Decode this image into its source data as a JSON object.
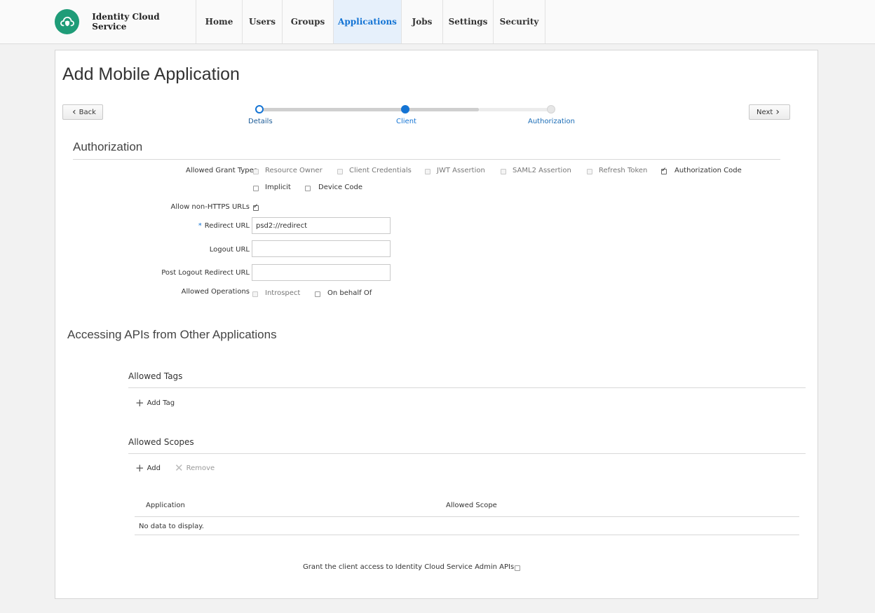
{
  "header": {
    "brand": "Identity Cloud Service",
    "nav": [
      {
        "label": "Home",
        "active": false
      },
      {
        "label": "Users",
        "active": false
      },
      {
        "label": "Groups",
        "active": false
      },
      {
        "label": "Applications",
        "active": true
      },
      {
        "label": "Jobs",
        "active": false
      },
      {
        "label": "Settings",
        "active": false
      },
      {
        "label": "Security",
        "active": false
      }
    ]
  },
  "page": {
    "title": "Add Mobile Application",
    "back_label": "Back",
    "next_label": "Next"
  },
  "train": {
    "steps": [
      {
        "label": "Details",
        "state": "visited"
      },
      {
        "label": "Client",
        "state": "current"
      },
      {
        "label": "Authorization",
        "state": "unvisited"
      }
    ]
  },
  "authorization": {
    "title": "Authorization",
    "grant_types_label": "Allowed Grant Types",
    "grant_types": [
      {
        "label": "Resource Owner",
        "checked": false,
        "disabled": true
      },
      {
        "label": "Client Credentials",
        "checked": false,
        "disabled": true
      },
      {
        "label": "JWT Assertion",
        "checked": false,
        "disabled": true
      },
      {
        "label": "SAML2 Assertion",
        "checked": false,
        "disabled": true
      },
      {
        "label": "Refresh Token",
        "checked": false,
        "disabled": true
      },
      {
        "label": "Authorization Code",
        "checked": true,
        "disabled": false
      },
      {
        "label": "Implicit",
        "checked": false,
        "disabled": false
      },
      {
        "label": "Device Code",
        "checked": false,
        "disabled": false
      }
    ],
    "non_https_label": "Allow non-HTTPS URLs",
    "non_https_checked": true,
    "required_marker": "*",
    "redirect_url_label": "Redirect URL",
    "redirect_url_value": "psd2://redirect",
    "logout_url_label": "Logout URL",
    "logout_url_value": "",
    "post_logout_label": "Post Logout Redirect URL",
    "post_logout_value": "",
    "operations_label": "Allowed Operations",
    "operations": [
      {
        "label": "Introspect",
        "checked": false,
        "disabled": true
      },
      {
        "label": "On behalf Of",
        "checked": false,
        "disabled": false
      }
    ]
  },
  "apis": {
    "title": "Accessing APIs from Other Applications",
    "tags_title": "Allowed Tags",
    "add_tag_label": "Add Tag",
    "scopes_title": "Allowed Scopes",
    "add_label": "Add",
    "remove_label": "Remove",
    "table_headers": [
      "Application",
      "Allowed Scope"
    ],
    "empty_text": "No data to display.",
    "admin_access_label": "Grant the client access to Identity Cloud Service Admin APIs."
  },
  "colors": {
    "accent": "#1474d4",
    "brand_green": "#1f9c78",
    "nav_active_bg": "#e6f0fb"
  }
}
